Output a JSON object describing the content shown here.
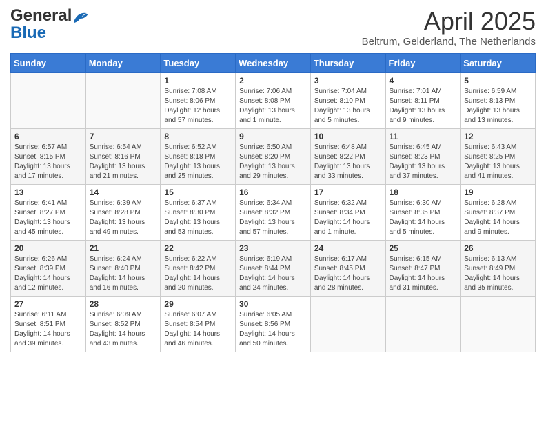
{
  "header": {
    "logo_general": "General",
    "logo_blue": "Blue",
    "month_title": "April 2025",
    "subtitle": "Beltrum, Gelderland, The Netherlands"
  },
  "weekdays": [
    "Sunday",
    "Monday",
    "Tuesday",
    "Wednesday",
    "Thursday",
    "Friday",
    "Saturday"
  ],
  "weeks": [
    [
      {
        "day": "",
        "info": ""
      },
      {
        "day": "",
        "info": ""
      },
      {
        "day": "1",
        "info": "Sunrise: 7:08 AM\nSunset: 8:06 PM\nDaylight: 12 hours\nand 57 minutes."
      },
      {
        "day": "2",
        "info": "Sunrise: 7:06 AM\nSunset: 8:08 PM\nDaylight: 13 hours\nand 1 minute."
      },
      {
        "day": "3",
        "info": "Sunrise: 7:04 AM\nSunset: 8:10 PM\nDaylight: 13 hours\nand 5 minutes."
      },
      {
        "day": "4",
        "info": "Sunrise: 7:01 AM\nSunset: 8:11 PM\nDaylight: 13 hours\nand 9 minutes."
      },
      {
        "day": "5",
        "info": "Sunrise: 6:59 AM\nSunset: 8:13 PM\nDaylight: 13 hours\nand 13 minutes."
      }
    ],
    [
      {
        "day": "6",
        "info": "Sunrise: 6:57 AM\nSunset: 8:15 PM\nDaylight: 13 hours\nand 17 minutes."
      },
      {
        "day": "7",
        "info": "Sunrise: 6:54 AM\nSunset: 8:16 PM\nDaylight: 13 hours\nand 21 minutes."
      },
      {
        "day": "8",
        "info": "Sunrise: 6:52 AM\nSunset: 8:18 PM\nDaylight: 13 hours\nand 25 minutes."
      },
      {
        "day": "9",
        "info": "Sunrise: 6:50 AM\nSunset: 8:20 PM\nDaylight: 13 hours\nand 29 minutes."
      },
      {
        "day": "10",
        "info": "Sunrise: 6:48 AM\nSunset: 8:22 PM\nDaylight: 13 hours\nand 33 minutes."
      },
      {
        "day": "11",
        "info": "Sunrise: 6:45 AM\nSunset: 8:23 PM\nDaylight: 13 hours\nand 37 minutes."
      },
      {
        "day": "12",
        "info": "Sunrise: 6:43 AM\nSunset: 8:25 PM\nDaylight: 13 hours\nand 41 minutes."
      }
    ],
    [
      {
        "day": "13",
        "info": "Sunrise: 6:41 AM\nSunset: 8:27 PM\nDaylight: 13 hours\nand 45 minutes."
      },
      {
        "day": "14",
        "info": "Sunrise: 6:39 AM\nSunset: 8:28 PM\nDaylight: 13 hours\nand 49 minutes."
      },
      {
        "day": "15",
        "info": "Sunrise: 6:37 AM\nSunset: 8:30 PM\nDaylight: 13 hours\nand 53 minutes."
      },
      {
        "day": "16",
        "info": "Sunrise: 6:34 AM\nSunset: 8:32 PM\nDaylight: 13 hours\nand 57 minutes."
      },
      {
        "day": "17",
        "info": "Sunrise: 6:32 AM\nSunset: 8:34 PM\nDaylight: 14 hours\nand 1 minute."
      },
      {
        "day": "18",
        "info": "Sunrise: 6:30 AM\nSunset: 8:35 PM\nDaylight: 14 hours\nand 5 minutes."
      },
      {
        "day": "19",
        "info": "Sunrise: 6:28 AM\nSunset: 8:37 PM\nDaylight: 14 hours\nand 9 minutes."
      }
    ],
    [
      {
        "day": "20",
        "info": "Sunrise: 6:26 AM\nSunset: 8:39 PM\nDaylight: 14 hours\nand 12 minutes."
      },
      {
        "day": "21",
        "info": "Sunrise: 6:24 AM\nSunset: 8:40 PM\nDaylight: 14 hours\nand 16 minutes."
      },
      {
        "day": "22",
        "info": "Sunrise: 6:22 AM\nSunset: 8:42 PM\nDaylight: 14 hours\nand 20 minutes."
      },
      {
        "day": "23",
        "info": "Sunrise: 6:19 AM\nSunset: 8:44 PM\nDaylight: 14 hours\nand 24 minutes."
      },
      {
        "day": "24",
        "info": "Sunrise: 6:17 AM\nSunset: 8:45 PM\nDaylight: 14 hours\nand 28 minutes."
      },
      {
        "day": "25",
        "info": "Sunrise: 6:15 AM\nSunset: 8:47 PM\nDaylight: 14 hours\nand 31 minutes."
      },
      {
        "day": "26",
        "info": "Sunrise: 6:13 AM\nSunset: 8:49 PM\nDaylight: 14 hours\nand 35 minutes."
      }
    ],
    [
      {
        "day": "27",
        "info": "Sunrise: 6:11 AM\nSunset: 8:51 PM\nDaylight: 14 hours\nand 39 minutes."
      },
      {
        "day": "28",
        "info": "Sunrise: 6:09 AM\nSunset: 8:52 PM\nDaylight: 14 hours\nand 43 minutes."
      },
      {
        "day": "29",
        "info": "Sunrise: 6:07 AM\nSunset: 8:54 PM\nDaylight: 14 hours\nand 46 minutes."
      },
      {
        "day": "30",
        "info": "Sunrise: 6:05 AM\nSunset: 8:56 PM\nDaylight: 14 hours\nand 50 minutes."
      },
      {
        "day": "",
        "info": ""
      },
      {
        "day": "",
        "info": ""
      },
      {
        "day": "",
        "info": ""
      }
    ]
  ]
}
